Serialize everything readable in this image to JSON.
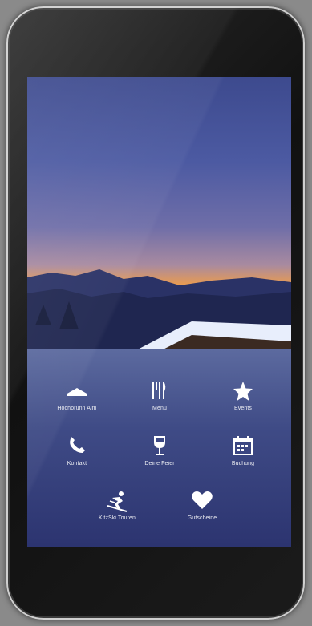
{
  "menu": {
    "items": [
      {
        "label": "Hochbrunn Alm",
        "icon": "hut-icon"
      },
      {
        "label": "Menü",
        "icon": "cutlery-icon"
      },
      {
        "label": "Events",
        "icon": "star-icon"
      },
      {
        "label": "Kontakt",
        "icon": "phone-icon"
      },
      {
        "label": "Deine Feier",
        "icon": "wine-glass-icon"
      },
      {
        "label": "Buchung",
        "icon": "calendar-icon"
      },
      {
        "label": "KitzSki Touren",
        "icon": "skier-icon"
      },
      {
        "label": "Gutscheine",
        "icon": "heart-icon"
      }
    ]
  },
  "colors": {
    "icon": "#ffffff",
    "sky_top": "#3d4a8e",
    "horizon": "#f0b25c"
  }
}
